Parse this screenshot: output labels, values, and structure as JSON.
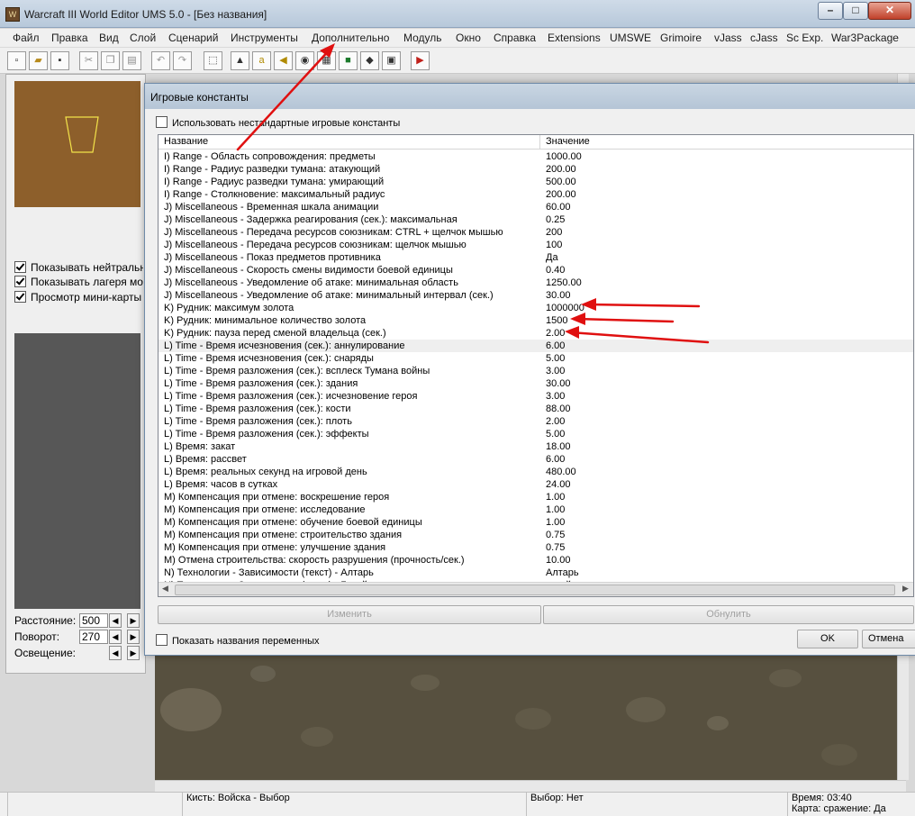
{
  "window": {
    "title": "Warcraft III World Editor UMS 5.0 - [Без названия]"
  },
  "menu": [
    "Файл",
    "Правка",
    "Вид",
    "Слой",
    "Сценарий",
    "Инструменты",
    "Дополнительно",
    "Модуль",
    "Окно",
    "Справка",
    "Extensions",
    "UMSWE",
    "Grimoire",
    "vJass",
    "cJass",
    "Sc Exp.",
    "War3Package"
  ],
  "left_panel": {
    "checkboxes": [
      {
        "label": "Показывать нейтральн",
        "checked": true
      },
      {
        "label": "Показывать лагеря мон",
        "checked": true
      },
      {
        "label": "Просмотр мини-карты",
        "checked": true
      }
    ],
    "distance_label": "Расстояние:",
    "distance_value": "500",
    "rotation_label": "Поворот:",
    "rotation_value": "270",
    "lighting_label": "Освещение:"
  },
  "dialog": {
    "title": "Игровые константы",
    "use_custom_label": "Использовать нестандартные игровые константы",
    "use_custom_checked": false,
    "col_name": "Название",
    "col_value": "Значение",
    "rows": [
      {
        "name": "I) Range - Область сопровождения: предметы",
        "value": "1000.00"
      },
      {
        "name": "I) Range - Радиус разведки тумана: атакующий",
        "value": "200.00"
      },
      {
        "name": "I) Range - Радиус разведки тумана: умирающий",
        "value": "500.00"
      },
      {
        "name": "I) Range - Столкновение: максимальный радиус",
        "value": "200.00"
      },
      {
        "name": "J) Miscellaneous - Временная шкала анимации",
        "value": "60.00"
      },
      {
        "name": "J) Miscellaneous - Задержка реагирования (сек.): максимальная",
        "value": "0.25"
      },
      {
        "name": "J) Miscellaneous - Передача ресурсов союзникам: CTRL + щелчок мышью",
        "value": "200"
      },
      {
        "name": "J) Miscellaneous - Передача ресурсов союзникам: щелчок мышью",
        "value": "100"
      },
      {
        "name": "J) Miscellaneous - Показ предметов противника",
        "value": "Да"
      },
      {
        "name": "J) Miscellaneous - Скорость смены видимости боевой единицы",
        "value": "0.40"
      },
      {
        "name": "J) Miscellaneous - Уведомление об атаке: минимальная область",
        "value": "1250.00"
      },
      {
        "name": "J) Miscellaneous - Уведомление об атаке: минимальный интервал (сек.)",
        "value": "30.00"
      },
      {
        "name": "K) Рудник: максимум золота",
        "value": "1000000"
      },
      {
        "name": "K) Рудник: минимальное количество золота",
        "value": "1500"
      },
      {
        "name": "K) Рудник: пауза перед сменой владельца (сек.)",
        "value": "2.00"
      },
      {
        "name": "L) Time - Время исчезновения (сек.): аннулирование",
        "value": "6.00"
      },
      {
        "name": "L) Time - Время исчезновения (сек.): снаряды",
        "value": "5.00"
      },
      {
        "name": "L) Time - Время разложения (сек.): всплеск Тумана войны",
        "value": "3.00"
      },
      {
        "name": "L) Time - Время разложения (сек.): здания",
        "value": "30.00"
      },
      {
        "name": "L) Time - Время разложения (сек.): исчезновение героя",
        "value": "3.00"
      },
      {
        "name": "L) Time - Время разложения (сек.): кости",
        "value": "88.00"
      },
      {
        "name": "L) Time - Время разложения (сек.): плоть",
        "value": "2.00"
      },
      {
        "name": "L) Time - Время разложения (сек.): эффекты",
        "value": "5.00"
      },
      {
        "name": "L) Время: закат",
        "value": "18.00"
      },
      {
        "name": "L) Время: рассвет",
        "value": "6.00"
      },
      {
        "name": "L) Время: реальных секунд на игровой день",
        "value": "480.00"
      },
      {
        "name": "L) Время: часов в сутках",
        "value": "24.00"
      },
      {
        "name": "M) Компенсация при отмене: воскрешение героя",
        "value": "1.00"
      },
      {
        "name": "M) Компенсация при отмене: исследование",
        "value": "1.00"
      },
      {
        "name": "M) Компенсация при отмене: обучение боевой единицы",
        "value": "1.00"
      },
      {
        "name": "M) Компенсация при отмене: строительство здания",
        "value": "0.75"
      },
      {
        "name": "M) Компенсация при отмене: улучшение здания",
        "value": "0.75"
      },
      {
        "name": "M) Отмена строительства: скорость разрушения (прочность/сек.)",
        "value": "10.00"
      },
      {
        "name": "N) Технологии - Зависимости (текст) - Алтарь",
        "value": "Алтарь"
      },
      {
        "name": "N) Технологии - Зависимости (текст) - Герой",
        "value": "герой"
      }
    ],
    "edit_button": "Изменить",
    "reset_button": "Обнулить",
    "show_varnames_label": "Показать названия переменных",
    "show_varnames_checked": false,
    "ok_button": "OK",
    "cancel_button": "Отмена"
  },
  "status": {
    "brush": "Кисть: Войска - Выбор",
    "selection": "Выбор: Нет",
    "time": "Время: 03:40",
    "map": "Карта: сражение: Да"
  },
  "colors": {
    "annotation_arrow": "#e01010"
  }
}
